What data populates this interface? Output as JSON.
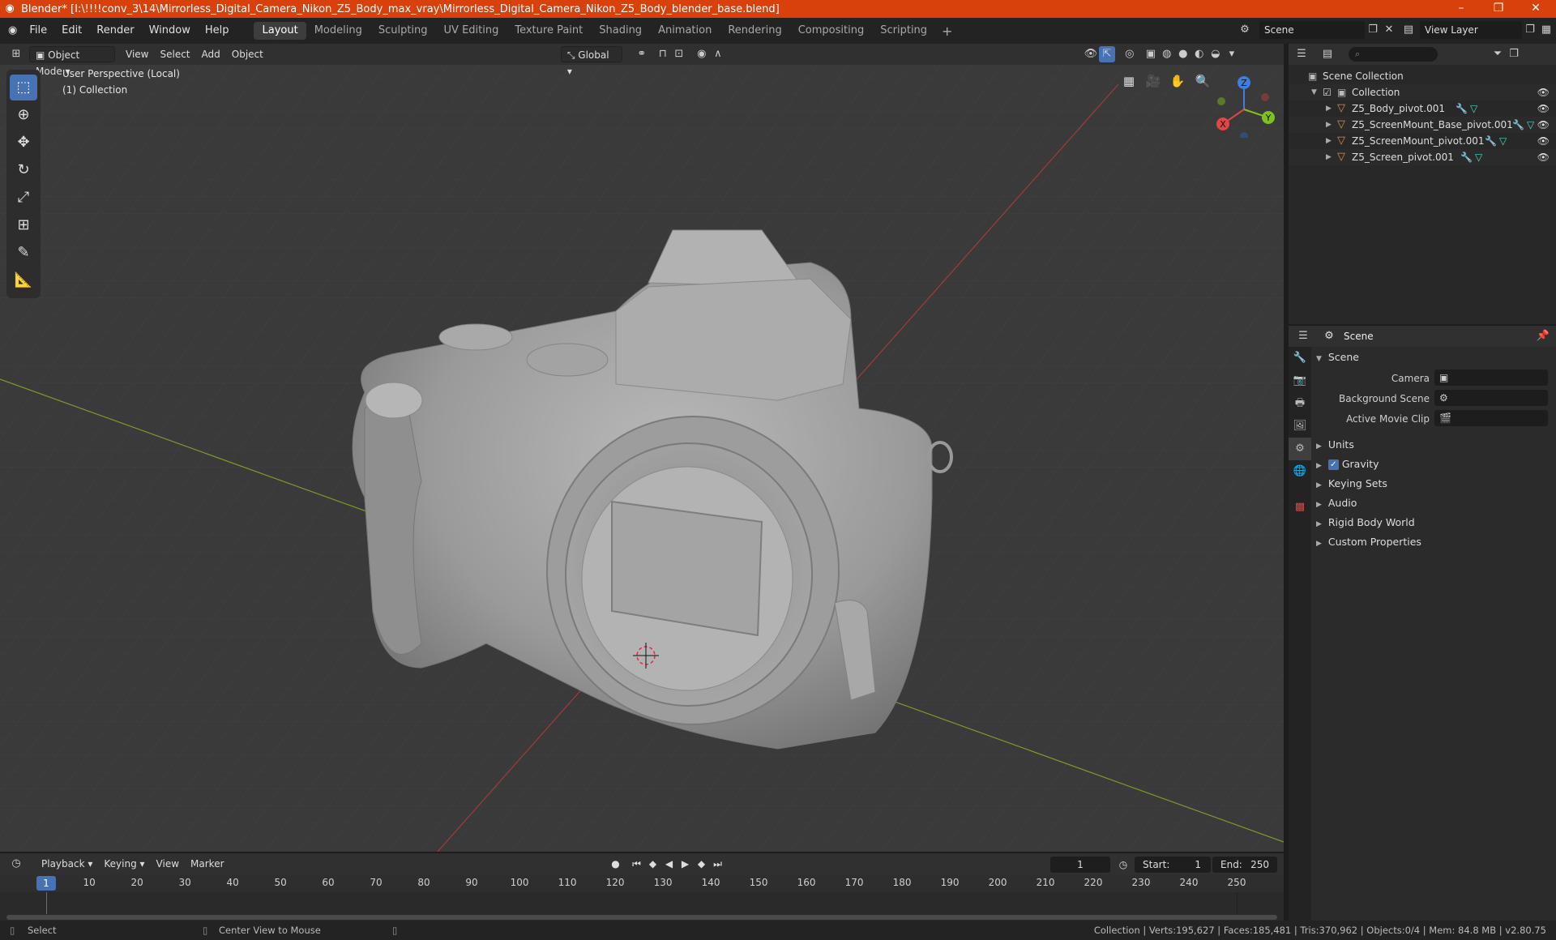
{
  "window": {
    "title": "Blender* [I:\\!!!!conv_3\\14\\Mirrorless_Digital_Camera_Nikon_Z5_Body_max_vray\\Mirrorless_Digital_Camera_Nikon_Z5_Body_blender_base.blend]",
    "controls": [
      "–",
      "❐",
      "✕"
    ]
  },
  "menu": {
    "items": [
      "File",
      "Edit",
      "Render",
      "Window",
      "Help"
    ],
    "workspaces": [
      "Layout",
      "Modeling",
      "Sculpting",
      "UV Editing",
      "Texture Paint",
      "Shading",
      "Animation",
      "Rendering",
      "Compositing",
      "Scripting"
    ],
    "active_workspace": "Layout",
    "add_tab": "+",
    "scene": "Scene",
    "view_layer": "View Layer"
  },
  "viewport": {
    "mode": "Object Mode",
    "menus": [
      "View",
      "Select",
      "Add",
      "Object"
    ],
    "orientation": "Global",
    "perspective_label": "User Perspective (Local)",
    "collection_label": "(1) Collection",
    "gizmo": {
      "x": "X",
      "y": "Y",
      "z": "Z"
    }
  },
  "outliner": {
    "root": "Scene Collection",
    "collection": "Collection",
    "objects": [
      "Z5_Body_pivot.001",
      "Z5_ScreenMount_Base_pivot.001",
      "Z5_ScreenMount_pivot.001",
      "Z5_Screen_pivot.001"
    ]
  },
  "properties": {
    "header": "Scene",
    "section": "Scene",
    "fields": [
      {
        "label": "Camera",
        "value": ""
      },
      {
        "label": "Background Scene",
        "value": ""
      },
      {
        "label": "Active Movie Clip",
        "value": ""
      }
    ],
    "subsections": [
      "Units",
      "Gravity",
      "Keying Sets",
      "Audio",
      "Rigid Body World",
      "Custom Properties"
    ],
    "gravity_checked": true
  },
  "timeline": {
    "menus": [
      "Playback",
      "Keying",
      "View",
      "Marker"
    ],
    "current_frame": "1",
    "start_label": "Start:",
    "start": "1",
    "end_label": "End:",
    "end": "250",
    "ticks": [
      "1",
      "10",
      "20",
      "30",
      "40",
      "50",
      "60",
      "70",
      "80",
      "90",
      "100",
      "110",
      "120",
      "130",
      "140",
      "150",
      "160",
      "170",
      "180",
      "190",
      "200",
      "210",
      "220",
      "230",
      "240",
      "250"
    ]
  },
  "status": {
    "select": "Select",
    "center": "Center View to Mouse",
    "stats": "Collection | Verts:195,627 | Faces:185,481 | Tris:370,962 | Objects:0/4 | Mem: 84.8 MB | v2.80.75"
  },
  "colors": {
    "accent": "#4772b3",
    "titlebar": "#d8400c",
    "object": "#e8883a"
  }
}
